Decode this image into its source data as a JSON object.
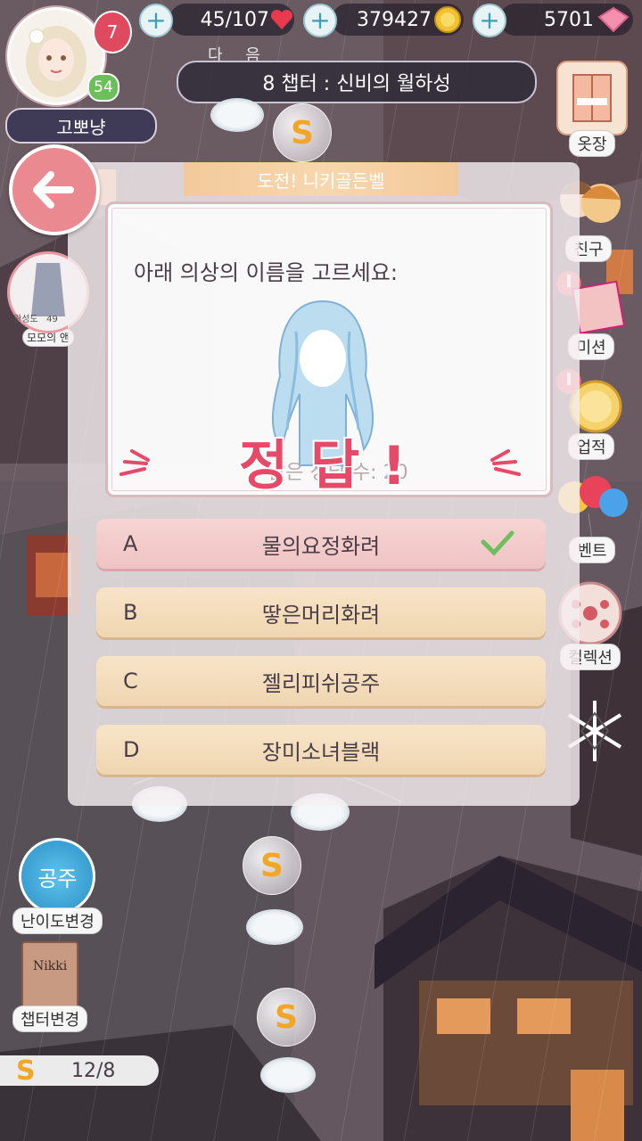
{
  "top_bar": {
    "level": "7",
    "vip_level": "54",
    "player_name": "고뽀냥",
    "stamina": "45/107",
    "gold": "379427",
    "diamonds": "5701"
  },
  "chapter": {
    "next_label": "다 음",
    "title": "8 챕터 :  신비의 월하성"
  },
  "right_menu": [
    {
      "label": "옷장",
      "icon": "wardrobe-icon"
    },
    {
      "label": "친구",
      "icon": "friends-icon"
    },
    {
      "label": "미션",
      "icon": "mission-icon"
    },
    {
      "label": "업적",
      "icon": "achievement-icon"
    },
    {
      "label": "벤트",
      "icon": "event-balloon-icon"
    },
    {
      "label": "컬렉션",
      "icon": "collection-icon"
    }
  ],
  "left_menu": {
    "outfit_label": "모모의 앤",
    "outfit_progress": "완성도   49",
    "difficulty_label": "난이도변경",
    "difficulty_mode": "공주",
    "chapter_change_label": "챕터변경",
    "book_title": "Nikki",
    "coin_progress": "12/8"
  },
  "quiz": {
    "banner": "도전! 니키골든벨",
    "question": "아래 의상의 이름을 고르세요:",
    "remaining": "남은 정답 수: 20",
    "result": "정 답 !",
    "answers": [
      {
        "letter": "A",
        "text": "물의요정화려",
        "selected": true
      },
      {
        "letter": "B",
        "text": "땋은머리화려",
        "selected": false
      },
      {
        "letter": "C",
        "text": "젤리피쉬공주",
        "selected": false
      },
      {
        "letter": "D",
        "text": "장미소녀블랙",
        "selected": false
      }
    ]
  },
  "colors": {
    "accent_pink": "#e74a68",
    "answer_gold": "#f0d6b1",
    "selected_pink": "#f0c3c3",
    "check_green": "#6cc05c"
  }
}
